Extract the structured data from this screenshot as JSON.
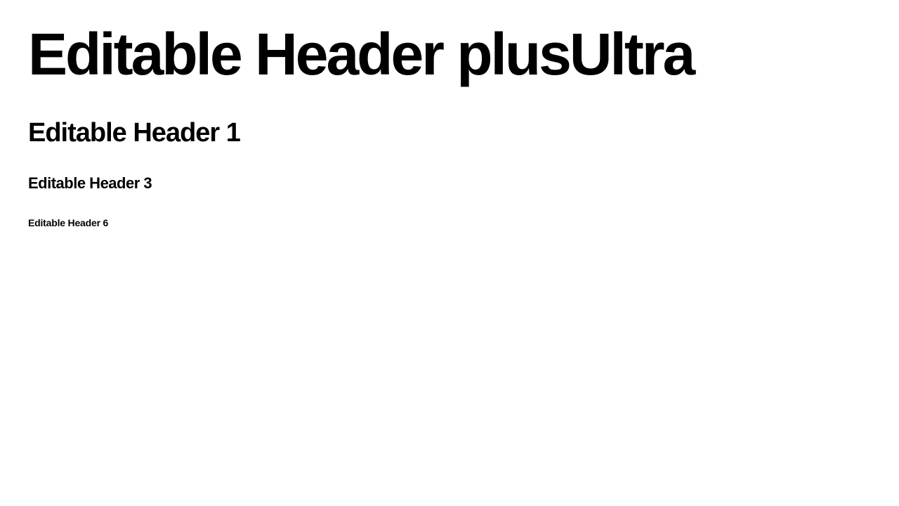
{
  "headers": {
    "plus_ultra": "Editable Header plusUltra",
    "h1": "Editable Header 1",
    "h3": "Editable Header 3",
    "h6": "Editable Header 6"
  }
}
